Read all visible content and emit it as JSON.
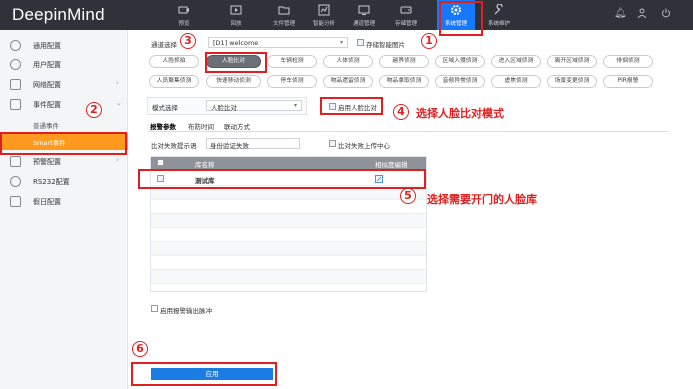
{
  "app": {
    "logo": "DeepinMind"
  },
  "nav": [
    {
      "label": "预览",
      "icon": "camera-icon"
    },
    {
      "label": "回放",
      "icon": "playback-icon"
    },
    {
      "label": "文件管理",
      "icon": "folder-icon"
    },
    {
      "label": "智能分析",
      "icon": "analytics-icon"
    },
    {
      "label": "通道管理",
      "icon": "channel-icon"
    },
    {
      "label": "存储管理",
      "icon": "storage-icon"
    },
    {
      "label": "系统管理",
      "icon": "gear-icon"
    },
    {
      "label": "系统维护",
      "icon": "wrench-icon"
    }
  ],
  "sidebar": {
    "items": [
      {
        "label": "通用配置",
        "icon": "settings-icon"
      },
      {
        "label": "用户配置",
        "icon": "user-icon"
      },
      {
        "label": "网络配置",
        "icon": "network-icon"
      },
      {
        "label": "事件配置",
        "icon": "event-icon"
      },
      {
        "label": "预警配置",
        "icon": "alert-icon"
      },
      {
        "label": "RS232配置",
        "icon": "serial-icon"
      },
      {
        "label": "假日配置",
        "icon": "calendar-icon"
      }
    ],
    "sub_items": [
      {
        "label": "普通事件"
      },
      {
        "label": "Smart事件"
      }
    ]
  },
  "channel": {
    "label": "通道选择",
    "value": "[D1] welcome",
    "save_image_label": "存储智能图片"
  },
  "chips": [
    [
      "人脸抓拍",
      "人脸比对",
      "车辆检测",
      "人体侦测",
      "越界侦测",
      "区域入侵侦测",
      "进入区域侦测",
      "离开区域侦测",
      "徘徊侦测"
    ],
    [
      "人员聚集侦测",
      "快速移动侦测",
      "停车侦测",
      "物品遗留侦测",
      "物品拿取侦测",
      "音频异常侦测",
      "虚焦侦测",
      "场景变更侦测",
      "PIR报警"
    ]
  ],
  "mode": {
    "label": "模式选择",
    "value": "人脸比对",
    "enable_label": "启用人脸比对"
  },
  "tabs": [
    "报警参数",
    "布防时间",
    "联动方式"
  ],
  "prompt": {
    "label": "比对失败提示语",
    "value": "身份验证失败",
    "upload_label": "比对失败上传中心"
  },
  "table": {
    "headers": [
      "库名称",
      "相似度编辑"
    ],
    "rows": [
      {
        "name": "测试库"
      }
    ]
  },
  "alarm_output_label": "启用报警输出脉冲",
  "apply_label": "应用",
  "annotations": {
    "step1": "1",
    "step2": "2",
    "step3": "3",
    "step4": "4",
    "step4_text": "选择人脸比对模式",
    "step5": "5",
    "step5_text": "选择需要开门的人脸库",
    "step6": "6"
  }
}
